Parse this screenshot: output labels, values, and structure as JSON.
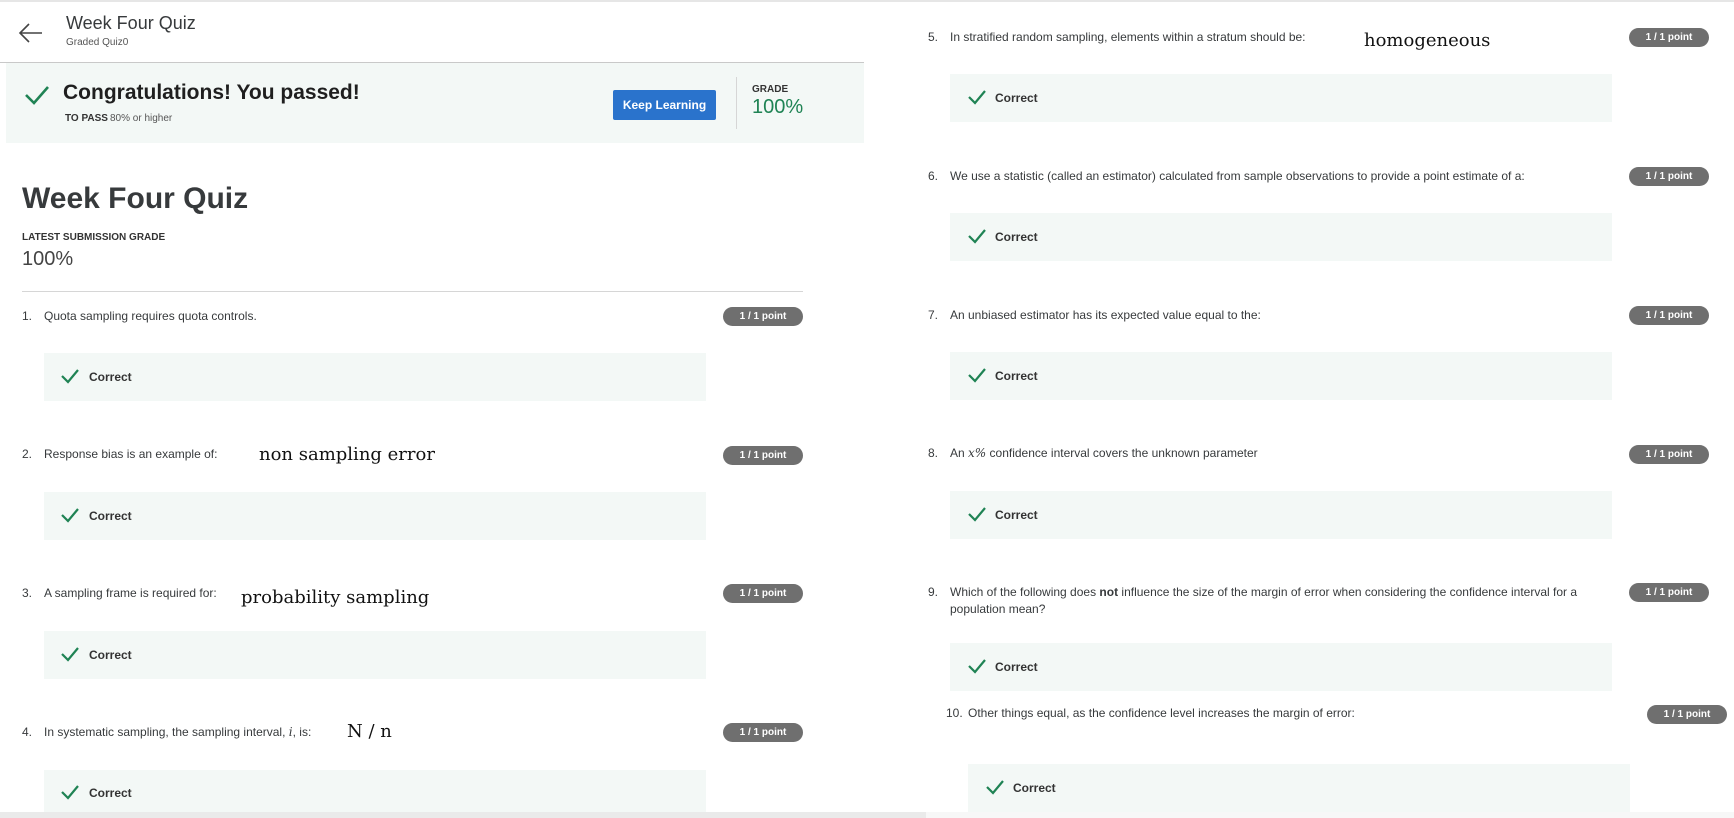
{
  "header": {
    "title": "Week Four Quiz",
    "subtitle": "Graded Quiz0",
    "back_icon": "arrow-left-icon"
  },
  "banner": {
    "title": "Congratulations! You passed!",
    "to_pass_label": "TO PASS",
    "to_pass_value": "80% or higher",
    "keep_learning": "Keep Learning",
    "grade_label": "GRADE",
    "grade_value": "100%",
    "check_icon": "checkmark-icon"
  },
  "quiz": {
    "title": "Week Four Quiz",
    "latest_label": "LATEST SUBMISSION GRADE",
    "latest_value": "100%"
  },
  "questions": [
    {
      "number": "1.",
      "text": "Quota sampling requires quota controls.",
      "score": "1 / 1 point",
      "feedback": "Correct",
      "answer": ""
    },
    {
      "number": "2.",
      "text": "Response bias is an example of:",
      "score": "1 / 1 point",
      "feedback": "Correct",
      "answer": "non sampling error"
    },
    {
      "number": "3.",
      "text": "A sampling frame is required for:",
      "score": "1 / 1 point",
      "feedback": "Correct",
      "answer": "probability sampling"
    },
    {
      "number": "4.",
      "text_before": "In systematic sampling, the sampling interval, ",
      "var": "i",
      "text_after": ", is:",
      "score": "1 / 1 point",
      "feedback": "Correct",
      "answer": "N / n"
    },
    {
      "number": "5.",
      "text": "In stratified random sampling, elements within a stratum should be:",
      "score": "1 / 1 point",
      "feedback": "Correct",
      "answer": "homogeneous"
    },
    {
      "number": "6.",
      "text": "We use a statistic (called an estimator) calculated from sample observations to provide a point estimate of a:",
      "score": "1 / 1 point",
      "feedback": "Correct",
      "answer": ""
    },
    {
      "number": "7.",
      "text": "An unbiased estimator has its expected value equal to the:",
      "score": "1 / 1 point",
      "feedback": "Correct",
      "answer": ""
    },
    {
      "number": "8.",
      "text_before": "An ",
      "var": "x%",
      "text_after": " confidence interval covers the unknown parameter",
      "score": "1 / 1 point",
      "feedback": "Correct",
      "answer": ""
    },
    {
      "number": "9.",
      "text_before": "Which of the following does ",
      "bold": "not",
      "text_after": " influence the size of the margin of error when considering the confidence interval for a population mean?",
      "score": "1 / 1 point",
      "feedback": "Correct",
      "answer": ""
    },
    {
      "number": "10.",
      "text": "Other things equal, as the confidence level increases the margin of error:",
      "score": "1 / 1 point",
      "feedback": "Correct",
      "answer": ""
    }
  ],
  "colors": {
    "accent": "#2a73cc",
    "success": "#1f8354",
    "pill": "#6f6f6f",
    "feedback_bg": "#f3f8f6"
  }
}
